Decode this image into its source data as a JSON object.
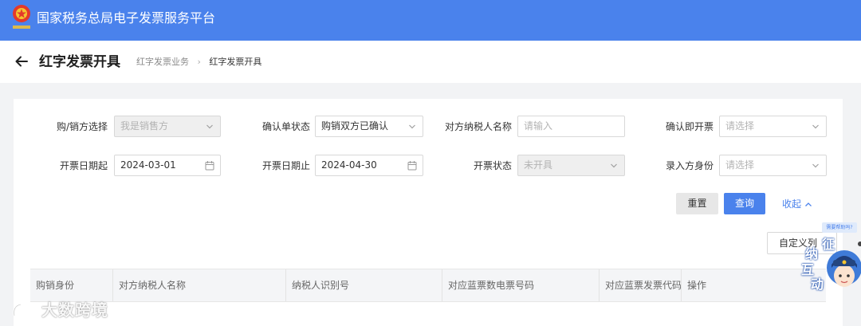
{
  "app": {
    "title": "国家税务总局电子发票服务平台"
  },
  "header": {
    "page_title": "红字发票开具",
    "breadcrumb": [
      "红字发票业务",
      "红字发票开具"
    ]
  },
  "filters": {
    "buyer_seller": {
      "label": "购/销方选择",
      "value": "我是销售方"
    },
    "confirm_status": {
      "label": "确认单状态",
      "value": "购销双方已确认"
    },
    "counterparty_name": {
      "label": "对方纳税人名称",
      "placeholder": "请输入"
    },
    "confirm_issue": {
      "label": "确认即开票",
      "placeholder": "请选择"
    },
    "issue_date_from": {
      "label": "开票日期起",
      "value": "2024-03-01"
    },
    "issue_date_to": {
      "label": "开票日期止",
      "value": "2024-04-30"
    },
    "issue_status": {
      "label": "开票状态",
      "value": "未开具"
    },
    "entry_role": {
      "label": "录入方身份",
      "placeholder": "请选择"
    }
  },
  "actions": {
    "reset": "重置",
    "query": "查询",
    "collapse": "收起",
    "custom_columns": "自定义列"
  },
  "table": {
    "columns": [
      "购销身份",
      "对方纳税人名称",
      "纳税人识别号",
      "对应蓝票数电票号码",
      "对应蓝票发票代码",
      "操作"
    ]
  },
  "help": {
    "tip": "需要帮助吗?",
    "mascot_chars": [
      "征",
      "纳",
      "互",
      "动"
    ]
  },
  "watermark": {
    "text": "大数跨境"
  },
  "colors": {
    "primary": "#4a82ec",
    "header_bg": "#4a82ec",
    "page_bg": "#f2f3f5"
  }
}
